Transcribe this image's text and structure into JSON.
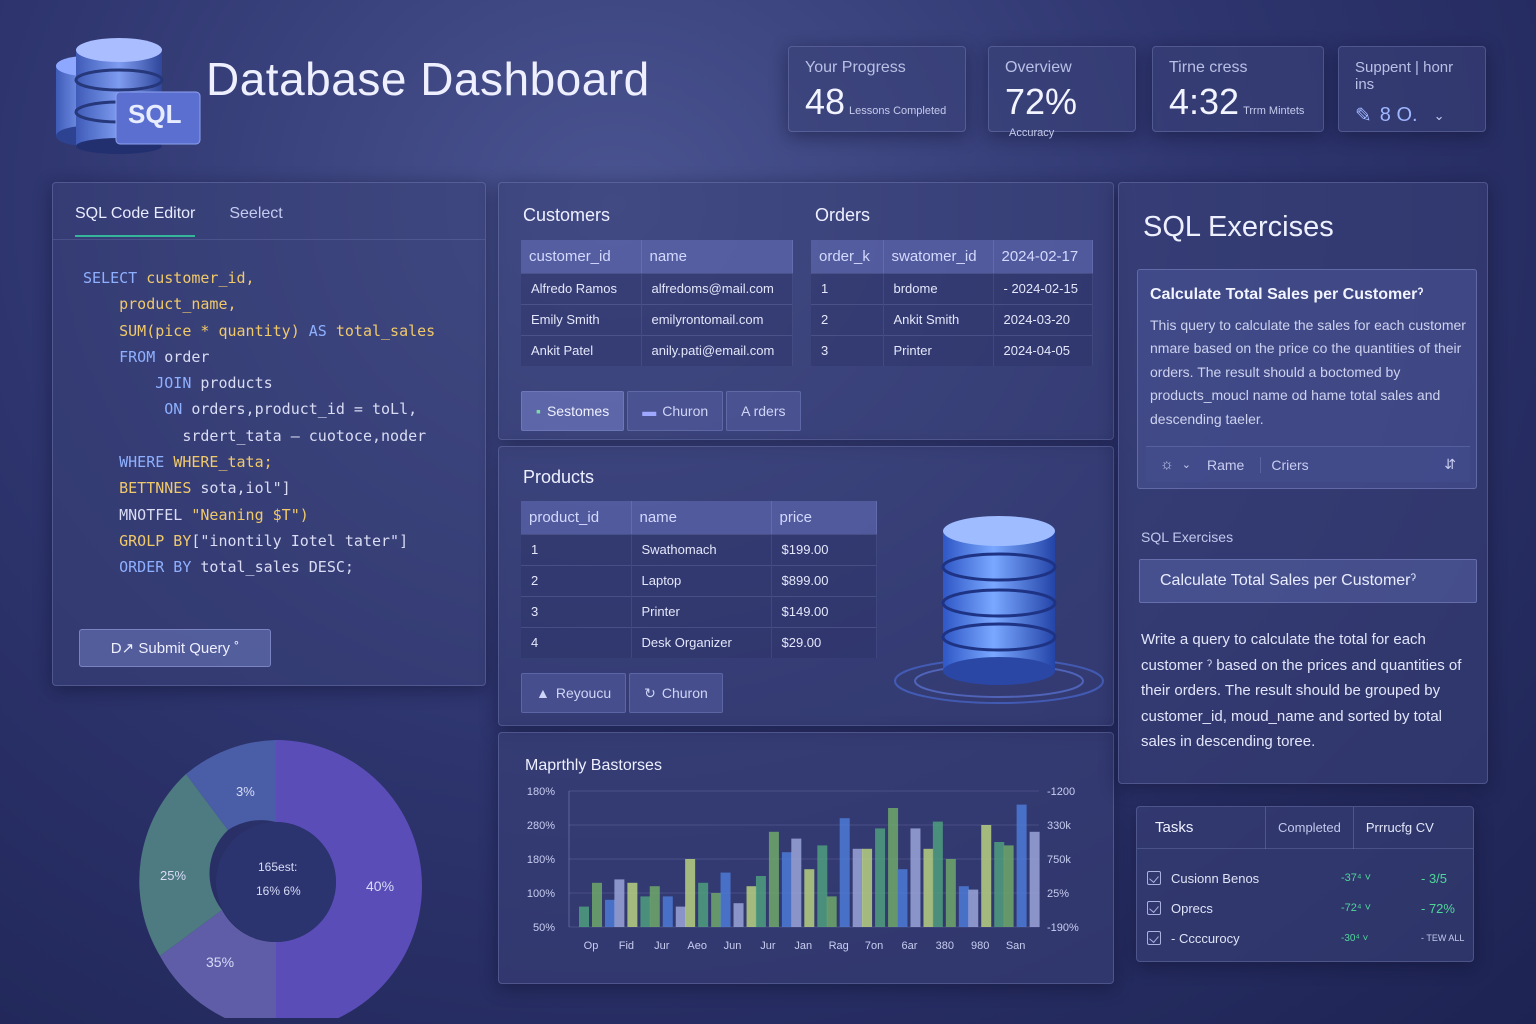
{
  "app": {
    "title": "Database Dashboard",
    "logo_text": "SQL"
  },
  "stats": [
    {
      "label": "Your Progress",
      "value": "48",
      "sub": "Lessons Completed"
    },
    {
      "label": "Overview",
      "value": "72%",
      "sub": "Accuracy"
    },
    {
      "label": "Tirne cress",
      "value": "4:32",
      "sub": "Trrm Mintets"
    },
    {
      "label": "Suppent | honr ins",
      "value": "8 O.",
      "icon": "pin-icon"
    }
  ],
  "editor": {
    "tabs": [
      "SQL Code Editor",
      "Seelect"
    ],
    "active_tab": 0,
    "submit_label": "D↗ Submit Query ˚"
  },
  "customers": {
    "title": "Customers",
    "columns": [
      "customer_id",
      "name"
    ],
    "rows": [
      [
        "Alfredo Ramos",
        "alfredoms@mail.com"
      ],
      [
        "Emily Smith",
        "emilyrontomail.com"
      ],
      [
        "Ankit Patel",
        "anily.pati@email.com"
      ]
    ]
  },
  "orders": {
    "title": "Orders",
    "columns": [
      "order_k",
      "swatomer_id",
      "2024-02-17"
    ],
    "rows": [
      [
        "1",
        "brdome",
        "- 2024-02-15"
      ],
      [
        "2",
        "Ankit Smith",
        "2024-03-20"
      ],
      [
        "3",
        "Printer",
        "2024-04-05"
      ]
    ]
  },
  "top_buttons": [
    "Sestomes",
    "Churon",
    "A rders"
  ],
  "products": {
    "title": "Products",
    "columns": [
      "product_id",
      "name",
      "price"
    ],
    "rows": [
      [
        "1",
        "Swathomach",
        "$199.00"
      ],
      [
        "2",
        "Laptop",
        "$899.00"
      ],
      [
        "3",
        "Printer",
        "$149.00"
      ],
      [
        "4",
        "Desk Organizer",
        "$29.00"
      ]
    ]
  },
  "product_buttons": [
    "Reyoucu",
    "Churon"
  ],
  "donut": {
    "labels": [
      "3%",
      "25%",
      "35%",
      "40%"
    ],
    "center_line1": "165est:",
    "center_line2": "16% 6%"
  },
  "exercises": {
    "title": "SQL Exercises",
    "card_title": "Calculate  Total Sales per Customerˀ",
    "card_body": "This query to calculate the sales for each customer nmare based on the price co the quantities of their orders. The result should a boctomed by products_moucl name od hame total sales and descending taeler.",
    "card_tabs": [
      "Rame",
      "Criers"
    ],
    "sub_label": "SQL Exercises",
    "select_value": "Calculate Total Sales per Customerˀ",
    "description": "Write a query to calculate the total for each customer ˀ based on the prices and quantities of their orders. The result should be grouped by customer_id, moud_name and sorted by total sales in descending toree."
  },
  "tasks": {
    "headers": [
      "Tasks",
      "Completed",
      "Prrrucfg CV"
    ],
    "rows": [
      {
        "name": "Cusionn Benos",
        "pct": "-37⁴ ˅",
        "val": "- 3/5"
      },
      {
        "name": "Oprecs",
        "pct": "-72⁴ ˅",
        "val": "- 72%"
      },
      {
        "name": "- Ccccurocy",
        "pct": "-30⁴ ˅",
        "val": "- TEW ALL"
      }
    ]
  },
  "chart_data": {
    "type": "bar",
    "title": "Maprthly Bastorses",
    "categories": [
      "Op",
      "Fid",
      "Jur",
      "Aeo",
      "Jun",
      "Jur",
      "Jan",
      "Rag",
      "7on",
      "6ar",
      "380",
      "980",
      "San"
    ],
    "left_ticks": [
      "180%",
      "280%",
      "180%",
      "100%",
      "50%"
    ],
    "right_ticks": [
      "-1200",
      "330k",
      "750k",
      "25%",
      "-190%"
    ],
    "series": [
      {
        "values": [
          0.6,
          1.4,
          1.2,
          2.0,
          1.6,
          1.5,
          2.6,
          0.9,
          2.3,
          1.7,
          3.1,
          1.1,
          2.4
        ]
      },
      {
        "values": [
          1.3,
          1.3,
          0.9,
          1.3,
          0.7,
          2.8,
          1.7,
          3.2,
          2.9,
          2.9,
          2.0,
          3.0,
          3.6
        ]
      },
      {
        "values": [
          0.8,
          0.9,
          0.6,
          1.0,
          1.2,
          2.2,
          2.4,
          2.3,
          3.5,
          2.3,
          1.2,
          2.5,
          2.8
        ]
      }
    ],
    "colors": [
      "#4f9e7e",
      "#6ea86a",
      "#4c7ad6",
      "#9aa5d8",
      "#b8d080"
    ],
    "ylim": [
      0,
      4
    ]
  }
}
